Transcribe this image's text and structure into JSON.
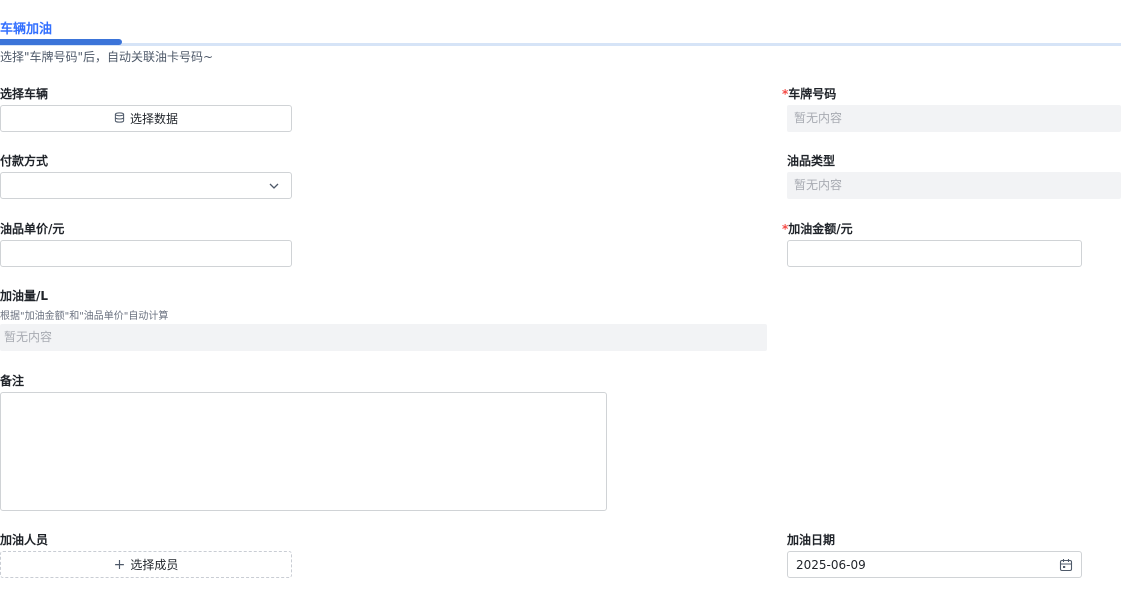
{
  "tab": {
    "label": "车辆加油"
  },
  "hint": "选择\"车牌号码\"后，自动关联油卡号码~",
  "fields": {
    "vehicle": {
      "label": "选择车辆",
      "button": "选择数据",
      "icon": "database-icon"
    },
    "plate": {
      "required_mark": "*",
      "label": "车牌号码",
      "placeholder": "暂无内容"
    },
    "payment": {
      "label": "付款方式",
      "value": ""
    },
    "oil_type": {
      "label": "油品类型",
      "placeholder": "暂无内容"
    },
    "unit_price": {
      "label": "油品单价/元",
      "value": ""
    },
    "amount": {
      "required_mark": "*",
      "label": "加油金额/元",
      "value": ""
    },
    "volume": {
      "label": "加油量/L",
      "hint": "根据\"加油金额\"和\"油品单价\"自动计算",
      "placeholder": "暂无内容"
    },
    "remark": {
      "label": "备注",
      "value": ""
    },
    "staff": {
      "label": "加油人员",
      "button": "选择成员",
      "icon": "plus-icon"
    },
    "date": {
      "label": "加油日期",
      "value": "2025-06-09",
      "icon": "calendar-icon"
    }
  },
  "colors": {
    "accent": "#3370ff",
    "tab_indicator": "#3b74d9",
    "required": "#f54a45",
    "readonly_bg": "#f2f3f5"
  }
}
